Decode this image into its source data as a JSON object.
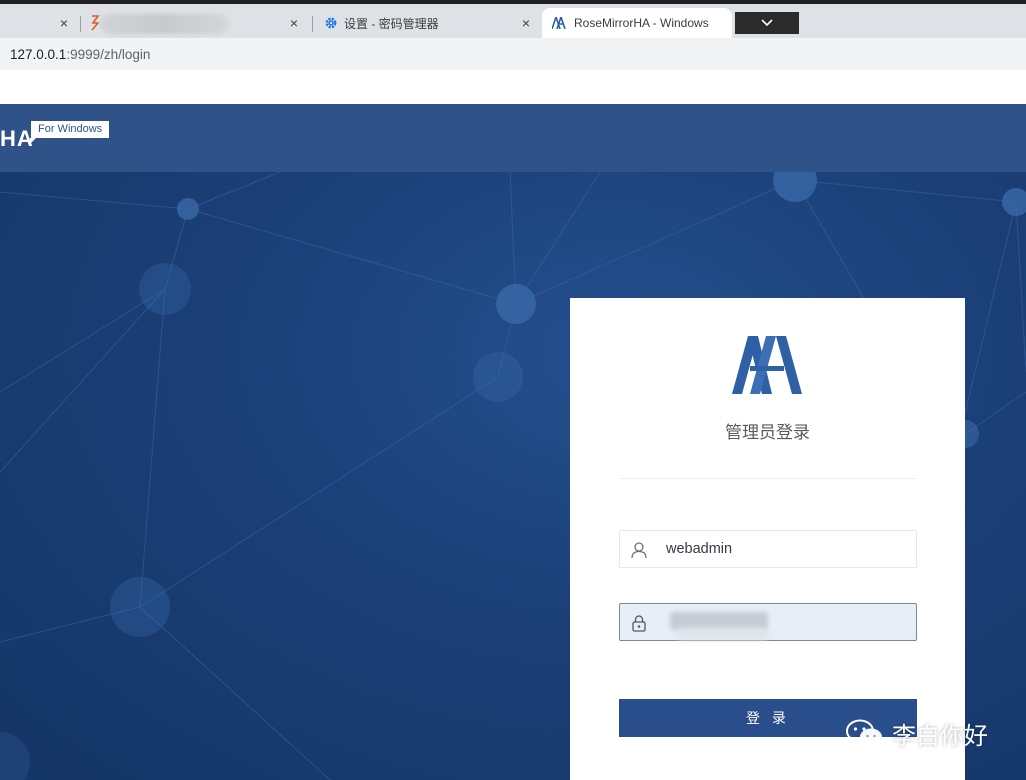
{
  "browser": {
    "tabs": [
      {
        "title": "",
        "close": "×"
      },
      {
        "title": "",
        "close": "×"
      },
      {
        "title": "设置 - 密码管理器",
        "close": "×"
      },
      {
        "title": "RoseMirrorHA - Windows",
        "close": "×"
      }
    ],
    "url_host": "127.0.0.1",
    "url_path": ":9999/zh/login"
  },
  "header": {
    "brand": "HA",
    "platform_badge": "For Windows"
  },
  "login": {
    "title": "管理员登录",
    "username_value": "webadmin",
    "button_label": "登 录"
  },
  "watermark": {
    "text": "李白你好"
  },
  "colors": {
    "header_bg": "#2f5389",
    "hero_bg": "#1b3f77",
    "button_bg": "#2a4d8c",
    "logo_blue": "#2f5fa4"
  }
}
